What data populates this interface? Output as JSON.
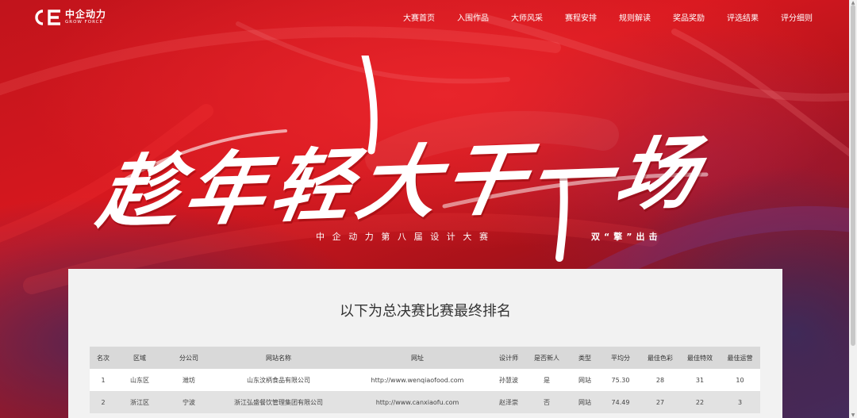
{
  "brand": {
    "name_cn": "中企动力",
    "name_en": "GROW FORCE",
    "color": "#ffffff"
  },
  "nav": {
    "items": [
      {
        "label": "大赛首页"
      },
      {
        "label": "入围作品"
      },
      {
        "label": "大师风采"
      },
      {
        "label": "赛程安排"
      },
      {
        "label": "规则解读"
      },
      {
        "label": "奖品奖励"
      },
      {
        "label": "评选结果"
      },
      {
        "label": "评分细则"
      }
    ]
  },
  "hero": {
    "slogan": "趁年轻大干一场",
    "subtitle_left": "中企动力第八届设计大赛",
    "subtitle_right": "双“擎”出击",
    "accent_color": "#d8181f"
  },
  "ranking": {
    "title": "以下为总决赛比赛最终排名",
    "columns": [
      "名次",
      "区域",
      "分公司",
      "网站名称",
      "网址",
      "设计师",
      "是否新人",
      "类型",
      "平均分",
      "最佳色彩",
      "最佳特效",
      "最佳运营"
    ],
    "rows": [
      [
        "1",
        "山东区",
        "潍坊",
        "山东汶柄食品有限公司",
        "http://www.wenqiaofood.com",
        "孙慧波",
        "是",
        "网站",
        "75.30",
        "28",
        "31",
        "10"
      ],
      [
        "2",
        "浙江区",
        "宁波",
        "浙江弘盛餐饮管理集团有限公司",
        "http://www.canxiaofu.com",
        "赵泽崇",
        "否",
        "网站",
        "74.49",
        "27",
        "22",
        "3"
      ]
    ]
  }
}
